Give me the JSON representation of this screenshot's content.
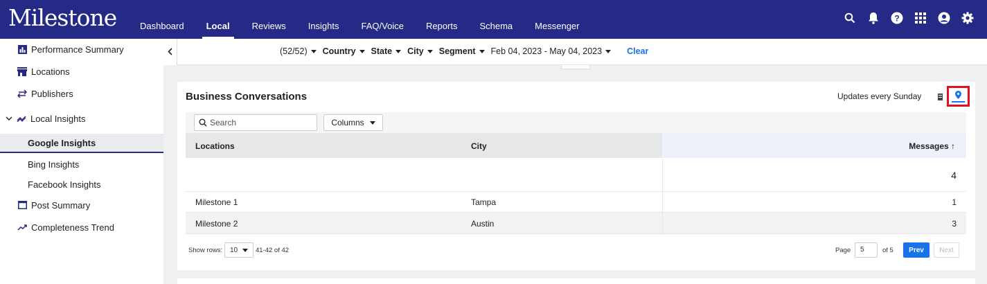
{
  "brand": {
    "logo": "Milestone",
    "color": "#252a86",
    "accent": "#1a73e8",
    "highlight": "#e3111b"
  },
  "nav": {
    "items": [
      {
        "label": "Dashboard"
      },
      {
        "label": "Local",
        "active": true
      },
      {
        "label": "Reviews"
      },
      {
        "label": "Insights"
      },
      {
        "label": "FAQ/Voice"
      },
      {
        "label": "Reports"
      },
      {
        "label": "Schema"
      },
      {
        "label": "Messenger"
      }
    ],
    "icons": [
      "search-icon",
      "bell-icon",
      "help-icon",
      "apps-grid-icon",
      "account-icon",
      "settings-gear-icon"
    ]
  },
  "sidebar": {
    "performance_summary": "Performance Summary",
    "locations": "Locations",
    "publishers": "Publishers",
    "local_insights": "Local Insights",
    "google_insights": "Google Insights",
    "bing_insights": "Bing Insights",
    "facebook_insights": "Facebook Insights",
    "post_summary": "Post Summary",
    "completeness_trend": "Completeness Trend"
  },
  "filters": {
    "locations_count": "(52/52)",
    "country": "Country",
    "state": "State",
    "city": "City",
    "segment": "Segment",
    "date_range": "Feb 04, 2023 - May 04, 2023",
    "clear": "Clear"
  },
  "card": {
    "title": "Business Conversations",
    "updates": "Updates every Sunday",
    "search_placeholder": "Search",
    "columns_label": "Columns",
    "headers": {
      "locations": "Locations",
      "city": "City",
      "messages": "Messages ↑"
    },
    "total_messages": "4",
    "rows": [
      {
        "location": "Milestone 1",
        "city": "Tampa",
        "messages": "1"
      },
      {
        "location": "Milestone 2",
        "city": "Austin",
        "messages": "3"
      }
    ]
  },
  "footer": {
    "show_rows_label": "Show rows:",
    "rows_value": "10",
    "range": "41-42 of 42",
    "page_label": "Page",
    "page_value": "5",
    "of_pages": "of 5",
    "prev": "Prev",
    "next": "Next"
  }
}
